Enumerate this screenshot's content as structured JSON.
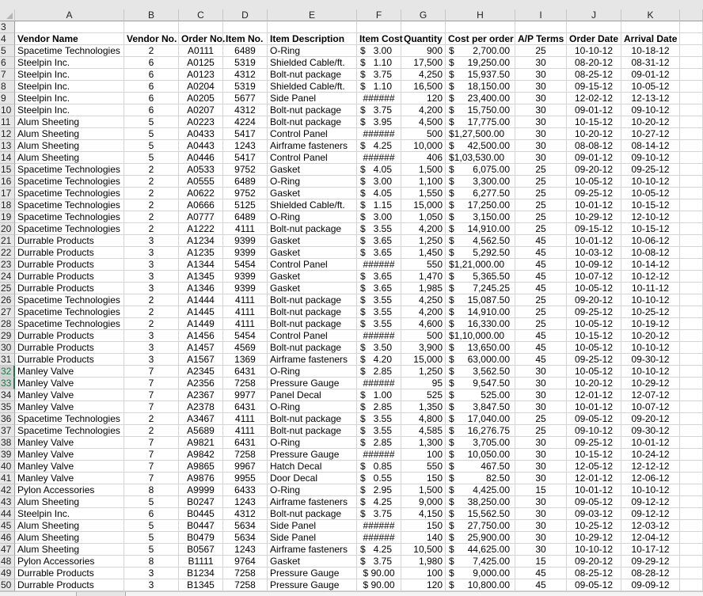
{
  "columns": [
    "A",
    "B",
    "C",
    "D",
    "E",
    "F",
    "G",
    "H",
    "I",
    "J",
    "K",
    ""
  ],
  "selected_rows": [
    32,
    33
  ],
  "accent_color": "#217346",
  "header_row": {
    "row_number": 4,
    "cells": [
      "Vendor Name",
      "Vendor No.",
      "Order No.",
      "Item No.",
      "Item Description",
      "Item Cost",
      "Quantity",
      "Cost per order",
      "A/P Terms",
      "Order Date",
      "Arrival Date"
    ]
  },
  "empty_row_number": 3,
  "rows": [
    {
      "n": 5,
      "vendor": "Spacetime Technologies",
      "vno": "2",
      "ord": "A0111",
      "item": "6489",
      "desc": "O-Ring",
      "cost": "3.00",
      "qty": "900",
      "cpo": "2,700.00",
      "terms": "25",
      "odate": "10-10-12",
      "adate": "10-18-12"
    },
    {
      "n": 6,
      "vendor": "Steelpin Inc.",
      "vno": "6",
      "ord": "A0125",
      "item": "5319",
      "desc": "Shielded Cable/ft.",
      "cost": "1.10",
      "qty": "17,500",
      "cpo": "19,250.00",
      "terms": "30",
      "odate": "08-20-12",
      "adate": "08-31-12"
    },
    {
      "n": 7,
      "vendor": "Steelpin Inc.",
      "vno": "6",
      "ord": "A0123",
      "item": "4312",
      "desc": "Bolt-nut package",
      "cost": "3.75",
      "qty": "4,250",
      "cpo": "15,937.50",
      "terms": "30",
      "odate": "08-25-12",
      "adate": "09-01-12"
    },
    {
      "n": 8,
      "vendor": "Steelpin Inc.",
      "vno": "6",
      "ord": "A0204",
      "item": "5319",
      "desc": "Shielded Cable/ft.",
      "cost": "1.10",
      "qty": "16,500",
      "cpo": "18,150.00",
      "terms": "30",
      "odate": "09-15-12",
      "adate": "10-05-12"
    },
    {
      "n": 9,
      "vendor": "Steelpin Inc.",
      "vno": "6",
      "ord": "A0205",
      "item": "5677",
      "desc": "Side Panel",
      "cost": "######",
      "qty": "120",
      "cpo": "23,400.00",
      "terms": "30",
      "odate": "12-02-12",
      "adate": "12-13-12"
    },
    {
      "n": 10,
      "vendor": "Steelpin Inc.",
      "vno": "6",
      "ord": "A0207",
      "item": "4312",
      "desc": "Bolt-nut package",
      "cost": "3.75",
      "qty": "4,200",
      "cpo": "15,750.00",
      "terms": "30",
      "odate": "09-01-12",
      "adate": "09-10-12"
    },
    {
      "n": 11,
      "vendor": "Alum Sheeting",
      "vno": "5",
      "ord": "A0223",
      "item": "4224",
      "desc": "Bolt-nut package",
      "cost": "3.95",
      "qty": "4,500",
      "cpo": "17,775.00",
      "terms": "30",
      "odate": "10-15-12",
      "adate": "10-20-12"
    },
    {
      "n": 12,
      "vendor": "Alum Sheeting",
      "vno": "5",
      "ord": "A0433",
      "item": "5417",
      "desc": "Control Panel",
      "cost": "######",
      "qty": "500",
      "cpo": "1,27,500.00",
      "terms": "30",
      "odate": "10-20-12",
      "adate": "10-27-12"
    },
    {
      "n": 13,
      "vendor": "Alum Sheeting",
      "vno": "5",
      "ord": "A0443",
      "item": "1243",
      "desc": "Airframe fasteners",
      "cost": "4.25",
      "qty": "10,000",
      "cpo": "42,500.00",
      "terms": "30",
      "odate": "08-08-12",
      "adate": "08-14-12"
    },
    {
      "n": 14,
      "vendor": "Alum Sheeting",
      "vno": "5",
      "ord": "A0446",
      "item": "5417",
      "desc": "Control Panel",
      "cost": "######",
      "qty": "406",
      "cpo": "1,03,530.00",
      "terms": "30",
      "odate": "09-01-12",
      "adate": "09-10-12"
    },
    {
      "n": 15,
      "vendor": "Spacetime Technologies",
      "vno": "2",
      "ord": "A0533",
      "item": "9752",
      "desc": "Gasket",
      "cost": "4.05",
      "qty": "1,500",
      "cpo": "6,075.00",
      "terms": "25",
      "odate": "09-20-12",
      "adate": "09-25-12"
    },
    {
      "n": 16,
      "vendor": "Spacetime Technologies",
      "vno": "2",
      "ord": "A0555",
      "item": "6489",
      "desc": "O-Ring",
      "cost": "3.00",
      "qty": "1,100",
      "cpo": "3,300.00",
      "terms": "25",
      "odate": "10-05-12",
      "adate": "10-10-12"
    },
    {
      "n": 17,
      "vendor": "Spacetime Technologies",
      "vno": "2",
      "ord": "A0622",
      "item": "9752",
      "desc": "Gasket",
      "cost": "4.05",
      "qty": "1,550",
      "cpo": "6,277.50",
      "terms": "25",
      "odate": "09-25-12",
      "adate": "10-05-12"
    },
    {
      "n": 18,
      "vendor": "Spacetime Technologies",
      "vno": "2",
      "ord": "A0666",
      "item": "5125",
      "desc": "Shielded Cable/ft.",
      "cost": "1.15",
      "qty": "15,000",
      "cpo": "17,250.00",
      "terms": "25",
      "odate": "10-01-12",
      "adate": "10-15-12"
    },
    {
      "n": 19,
      "vendor": "Spacetime Technologies",
      "vno": "2",
      "ord": "A0777",
      "item": "6489",
      "desc": "O-Ring",
      "cost": "3.00",
      "qty": "1,050",
      "cpo": "3,150.00",
      "terms": "25",
      "odate": "10-29-12",
      "adate": "12-10-12"
    },
    {
      "n": 20,
      "vendor": "Spacetime Technologies",
      "vno": "2",
      "ord": "A1222",
      "item": "4111",
      "desc": "Bolt-nut package",
      "cost": "3.55",
      "qty": "4,200",
      "cpo": "14,910.00",
      "terms": "25",
      "odate": "09-15-12",
      "adate": "10-15-12"
    },
    {
      "n": 21,
      "vendor": "Durrable Products",
      "vno": "3",
      "ord": "A1234",
      "item": "9399",
      "desc": "Gasket",
      "cost": "3.65",
      "qty": "1,250",
      "cpo": "4,562.50",
      "terms": "45",
      "odate": "10-01-12",
      "adate": "10-06-12"
    },
    {
      "n": 22,
      "vendor": "Durrable Products",
      "vno": "3",
      "ord": "A1235",
      "item": "9399",
      "desc": "Gasket",
      "cost": "3.65",
      "qty": "1,450",
      "cpo": "5,292.50",
      "terms": "45",
      "odate": "10-03-12",
      "adate": "10-08-12"
    },
    {
      "n": 23,
      "vendor": "Durrable Products",
      "vno": "3",
      "ord": "A1344",
      "item": "5454",
      "desc": "Control Panel",
      "cost": "######",
      "qty": "550",
      "cpo": "1,21,000.00",
      "terms": "45",
      "odate": "10-09-12",
      "adate": "10-14-12"
    },
    {
      "n": 24,
      "vendor": "Durrable Products",
      "vno": "3",
      "ord": "A1345",
      "item": "9399",
      "desc": "Gasket",
      "cost": "3.65",
      "qty": "1,470",
      "cpo": "5,365.50",
      "terms": "45",
      "odate": "10-07-12",
      "adate": "10-12-12"
    },
    {
      "n": 25,
      "vendor": "Durrable Products",
      "vno": "3",
      "ord": "A1346",
      "item": "9399",
      "desc": "Gasket",
      "cost": "3.65",
      "qty": "1,985",
      "cpo": "7,245.25",
      "terms": "45",
      "odate": "10-05-12",
      "adate": "10-11-12"
    },
    {
      "n": 26,
      "vendor": "Spacetime Technologies",
      "vno": "2",
      "ord": "A1444",
      "item": "4111",
      "desc": "Bolt-nut package",
      "cost": "3.55",
      "qty": "4,250",
      "cpo": "15,087.50",
      "terms": "25",
      "odate": "09-20-12",
      "adate": "10-10-12"
    },
    {
      "n": 27,
      "vendor": "Spacetime Technologies",
      "vno": "2",
      "ord": "A1445",
      "item": "4111",
      "desc": "Bolt-nut package",
      "cost": "3.55",
      "qty": "4,200",
      "cpo": "14,910.00",
      "terms": "25",
      "odate": "09-25-12",
      "adate": "10-25-12"
    },
    {
      "n": 28,
      "vendor": "Spacetime Technologies",
      "vno": "2",
      "ord": "A1449",
      "item": "4111",
      "desc": "Bolt-nut package",
      "cost": "3.55",
      "qty": "4,600",
      "cpo": "16,330.00",
      "terms": "25",
      "odate": "10-05-12",
      "adate": "10-19-12"
    },
    {
      "n": 29,
      "vendor": "Durrable Products",
      "vno": "3",
      "ord": "A1456",
      "item": "5454",
      "desc": "Control Panel",
      "cost": "######",
      "qty": "500",
      "cpo": "1,10,000.00",
      "terms": "45",
      "odate": "10-15-12",
      "adate": "10-20-12"
    },
    {
      "n": 30,
      "vendor": "Durrable Products",
      "vno": "3",
      "ord": "A1457",
      "item": "4569",
      "desc": "Bolt-nut package",
      "cost": "3.50",
      "qty": "3,900",
      "cpo": "13,650.00",
      "terms": "45",
      "odate": "10-05-12",
      "adate": "10-10-12"
    },
    {
      "n": 31,
      "vendor": "Durrable Products",
      "vno": "3",
      "ord": "A1567",
      "item": "1369",
      "desc": "Airframe fasteners",
      "cost": "4.20",
      "qty": "15,000",
      "cpo": "63,000.00",
      "terms": "45",
      "odate": "09-25-12",
      "adate": "09-30-12"
    },
    {
      "n": 32,
      "vendor": "Manley Valve",
      "vno": "7",
      "ord": "A2345",
      "item": "6431",
      "desc": "O-Ring",
      "cost": "2.85",
      "qty": "1,250",
      "cpo": "3,562.50",
      "terms": "30",
      "odate": "10-05-12",
      "adate": "10-10-12"
    },
    {
      "n": 33,
      "vendor": "Manley Valve",
      "vno": "7",
      "ord": "A2356",
      "item": "7258",
      "desc": "Pressure Gauge",
      "cost": "######",
      "qty": "95",
      "cpo": "9,547.50",
      "terms": "30",
      "odate": "10-20-12",
      "adate": "10-29-12"
    },
    {
      "n": 34,
      "vendor": "Manley Valve",
      "vno": "7",
      "ord": "A2367",
      "item": "9977",
      "desc": "Panel Decal",
      "cost": "1.00",
      "qty": "525",
      "cpo": "525.00",
      "terms": "30",
      "odate": "12-01-12",
      "adate": "12-07-12"
    },
    {
      "n": 35,
      "vendor": "Manley Valve",
      "vno": "7",
      "ord": "A2378",
      "item": "6431",
      "desc": "O-Ring",
      "cost": "2.85",
      "qty": "1,350",
      "cpo": "3,847.50",
      "terms": "30",
      "odate": "10-01-12",
      "adate": "10-07-12"
    },
    {
      "n": 36,
      "vendor": "Spacetime Technologies",
      "vno": "2",
      "ord": "A3467",
      "item": "4111",
      "desc": "Bolt-nut package",
      "cost": "3.55",
      "qty": "4,800",
      "cpo": "17,040.00",
      "terms": "25",
      "odate": "09-05-12",
      "adate": "09-20-12"
    },
    {
      "n": 37,
      "vendor": "Spacetime Technologies",
      "vno": "2",
      "ord": "A5689",
      "item": "4111",
      "desc": "Bolt-nut package",
      "cost": "3.55",
      "qty": "4,585",
      "cpo": "16,276.75",
      "terms": "25",
      "odate": "09-10-12",
      "adate": "09-30-12"
    },
    {
      "n": 38,
      "vendor": "Manley Valve",
      "vno": "7",
      "ord": "A9821",
      "item": "6431",
      "desc": "O-Ring",
      "cost": "2.85",
      "qty": "1,300",
      "cpo": "3,705.00",
      "terms": "30",
      "odate": "09-25-12",
      "adate": "10-01-12"
    },
    {
      "n": 39,
      "vendor": "Manley Valve",
      "vno": "7",
      "ord": "A9842",
      "item": "7258",
      "desc": "Pressure Gauge",
      "cost": "######",
      "qty": "100",
      "cpo": "10,050.00",
      "terms": "30",
      "odate": "10-15-12",
      "adate": "10-24-12"
    },
    {
      "n": 40,
      "vendor": "Manley Valve",
      "vno": "7",
      "ord": "A9865",
      "item": "9967",
      "desc": "Hatch Decal",
      "cost": "0.85",
      "qty": "550",
      "cpo": "467.50",
      "terms": "30",
      "odate": "12-05-12",
      "adate": "12-12-12"
    },
    {
      "n": 41,
      "vendor": "Manley Valve",
      "vno": "7",
      "ord": "A9876",
      "item": "9955",
      "desc": "Door Decal",
      "cost": "0.55",
      "qty": "150",
      "cpo": "82.50",
      "terms": "30",
      "odate": "12-01-12",
      "adate": "12-06-12"
    },
    {
      "n": 42,
      "vendor": "Pylon Accessories",
      "vno": "8",
      "ord": "A9999",
      "item": "6433",
      "desc": "O-Ring",
      "cost": "2.95",
      "qty": "1,500",
      "cpo": "4,425.00",
      "terms": "15",
      "odate": "10-01-12",
      "adate": "10-10-12"
    },
    {
      "n": 43,
      "vendor": "Alum Sheeting",
      "vno": "5",
      "ord": "B0247",
      "item": "1243",
      "desc": "Airframe fasteners",
      "cost": "4.25",
      "qty": "9,000",
      "cpo": "38,250.00",
      "terms": "30",
      "odate": "09-05-12",
      "adate": "09-12-12"
    },
    {
      "n": 44,
      "vendor": "Steelpin Inc.",
      "vno": "6",
      "ord": "B0445",
      "item": "4312",
      "desc": "Bolt-nut package",
      "cost": "3.75",
      "qty": "4,150",
      "cpo": "15,562.50",
      "terms": "30",
      "odate": "09-03-12",
      "adate": "09-12-12"
    },
    {
      "n": 45,
      "vendor": "Alum Sheeting",
      "vno": "5",
      "ord": "B0447",
      "item": "5634",
      "desc": "Side Panel",
      "cost": "######",
      "qty": "150",
      "cpo": "27,750.00",
      "terms": "30",
      "odate": "10-25-12",
      "adate": "12-03-12"
    },
    {
      "n": 46,
      "vendor": "Alum Sheeting",
      "vno": "5",
      "ord": "B0479",
      "item": "5634",
      "desc": "Side Panel",
      "cost": "######",
      "qty": "140",
      "cpo": "25,900.00",
      "terms": "30",
      "odate": "10-29-12",
      "adate": "12-04-12"
    },
    {
      "n": 47,
      "vendor": "Alum Sheeting",
      "vno": "5",
      "ord": "B0567",
      "item": "1243",
      "desc": "Airframe fasteners",
      "cost": "4.25",
      "qty": "10,500",
      "cpo": "44,625.00",
      "terms": "30",
      "odate": "10-10-12",
      "adate": "10-17-12"
    },
    {
      "n": 48,
      "vendor": "Pylon Accessories",
      "vno": "8",
      "ord": "B1111",
      "item": "9764",
      "desc": "Gasket",
      "cost": "3.75",
      "qty": "1,980",
      "cpo": "7,425.00",
      "terms": "15",
      "odate": "09-20-12",
      "adate": "09-29-12"
    },
    {
      "n": 49,
      "vendor": "Durrable Products",
      "vno": "3",
      "ord": "B1234",
      "item": "7258",
      "desc": "Pressure Gauge",
      "cost": "$ 90.00",
      "qty": "100",
      "cpo": "9,000.00",
      "terms": "45",
      "odate": "08-25-12",
      "adate": "08-28-12"
    },
    {
      "n": 50,
      "vendor": "Durrable Products",
      "vno": "3",
      "ord": "B1345",
      "item": "7258",
      "desc": "Pressure Gauge",
      "cost": "$ 90.00",
      "qty": "120",
      "cpo": "10,800.00",
      "terms": "45",
      "odate": "09-05-12",
      "adate": "09-09-12"
    }
  ],
  "currency_symbol": "$"
}
